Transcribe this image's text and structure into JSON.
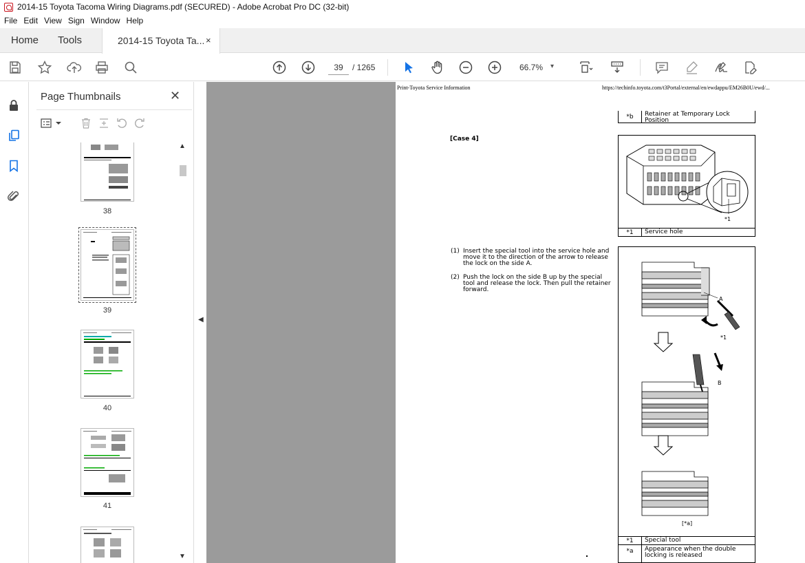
{
  "window": {
    "title": "2014-15 Toyota Tacoma Wiring Diagrams.pdf (SECURED) - Adobe Acrobat Pro DC (32-bit)"
  },
  "menu": [
    "File",
    "Edit",
    "View",
    "Sign",
    "Window",
    "Help"
  ],
  "tabs": {
    "home": "Home",
    "tools": "Tools",
    "document": "2014-15 Toyota Ta...",
    "close": "×"
  },
  "toolbar": {
    "page_current": "39",
    "page_total": "/ 1265",
    "zoom": "66.7%",
    "zoom_caret": "▾"
  },
  "thumbnails": {
    "title": "Page Thumbnails",
    "close": "✕",
    "pages": [
      "38",
      "39",
      "40",
      "41"
    ],
    "selected_page": "39"
  },
  "document_page": {
    "header_left": "Print-Toyota Service Information",
    "header_right": "https://techinfo.toyota.com/t3Portal/external/en/ewdappu/EM26B0U/ewd/...",
    "legend_top": {
      "key": "*b",
      "value": "Retainer at Temporary Lock Position"
    },
    "case_heading": "[Case 4]",
    "figure1_legend": {
      "key": "*1",
      "value": "Service hole"
    },
    "figure1_label": "*1",
    "steps": [
      {
        "num": "(1)",
        "text": "Insert the special tool into the service hole and move it to the direction of the arrow to release the lock on the side A."
      },
      {
        "num": "(2)",
        "text": "Push the lock on the side B up by the special tool and release the lock. Then pull the retainer forward."
      }
    ],
    "figure2_labels": {
      "a": "A",
      "b": "B",
      "tool": "*1",
      "appearance": "[*a]"
    },
    "figure2_legend": [
      {
        "key": "*1",
        "value": "Special tool"
      },
      {
        "key": "*a",
        "value": "Appearance when the double locking is released"
      }
    ]
  },
  "colors": {
    "accent_blue": "#1473e6",
    "doc_background": "#9b9b9b",
    "acrobat_red": "#c8141e"
  }
}
